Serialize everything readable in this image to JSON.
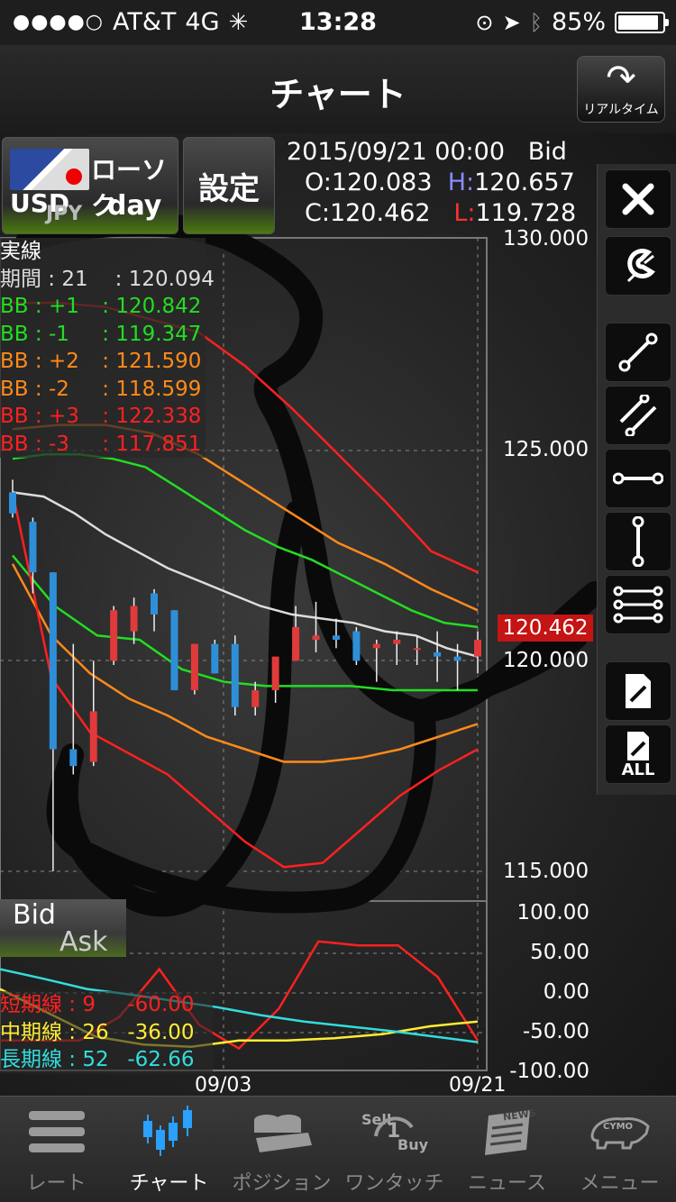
{
  "status_bar": {
    "signal": "●●●●○",
    "carrier": "AT&T",
    "network": "4G",
    "time": "13:28",
    "battery": "85%"
  },
  "nav": {
    "title": "チャート",
    "realtime_label": "リアルタイム"
  },
  "symbol_button": {
    "base": "USD",
    "quote": "JPY",
    "chart_type": "ローソク",
    "period": "day"
  },
  "settings_button": {
    "label": "設定"
  },
  "ohlc": {
    "datetime": "2015/09/21 00:00",
    "side": "Bid",
    "open_label": "O:",
    "open": "120.083",
    "high_label": "H:",
    "high": "120.657",
    "close_label": "C:",
    "close": "120.462",
    "low_label": "L:",
    "low": "119.728"
  },
  "main_legend": {
    "title": "実線",
    "rows": [
      {
        "name": "期間",
        "param": "21",
        "value": "120.094",
        "color": "#dddddd"
      },
      {
        "name": "BB",
        "param": "+1",
        "value": "120.842",
        "color": "#22dd22"
      },
      {
        "name": "BB",
        "param": "-1",
        "value": "119.347",
        "color": "#22dd22"
      },
      {
        "name": "BB",
        "param": "+2",
        "value": "121.590",
        "color": "#ff8a1a"
      },
      {
        "name": "BB",
        "param": "-2",
        "value": "118.599",
        "color": "#ff8a1a"
      },
      {
        "name": "BB",
        "param": "+3",
        "value": "122.338",
        "color": "#ff2020"
      },
      {
        "name": "BB",
        "param": "-3",
        "value": "117.851",
        "color": "#ff2020"
      }
    ]
  },
  "price_axis": {
    "ticks": [
      "130.000",
      "125.000",
      "120.000",
      "115.000"
    ],
    "current": "120.462"
  },
  "osc_toggle": {
    "bid": "Bid",
    "ask": "Ask"
  },
  "osc_legend": {
    "rows": [
      {
        "name": "短期線",
        "param": "9",
        "value": "-60.00",
        "color": "#ff2020"
      },
      {
        "name": "中期線",
        "param": "26",
        "value": "-36.00",
        "color": "#ffee33"
      },
      {
        "name": "長期線",
        "param": "52",
        "value": "-62.66",
        "color": "#33dddd"
      }
    ]
  },
  "osc_axis": {
    "ticks": [
      "100.00",
      "50.00",
      "0.00",
      "-50.00",
      "-100.00"
    ]
  },
  "date_axis": {
    "ticks": [
      "09/03",
      "09/21"
    ]
  },
  "toolbar": {
    "tools": [
      "close-icon",
      "magnet-icon",
      "trend-line-icon",
      "parallel-lines-icon",
      "horizontal-line-icon",
      "vertical-line-icon",
      "multi-line-icon",
      "erase-icon",
      "erase-all-icon"
    ],
    "erase_all_label": "ALL"
  },
  "tabbar": {
    "tabs": [
      {
        "label": "レート",
        "icon": "rate-list-icon",
        "active": false
      },
      {
        "label": "チャート",
        "icon": "chart-icon",
        "active": true
      },
      {
        "label": "ポジション",
        "icon": "position-icon",
        "active": false
      },
      {
        "label": "ワンタッチ",
        "icon": "one-touch-icon",
        "active": false
      },
      {
        "label": "ニュース",
        "icon": "news-icon",
        "active": false
      },
      {
        "label": "メニュー",
        "icon": "menu-icon",
        "active": false
      }
    ],
    "onetouch_sell": "Sell",
    "onetouch_buy": "Buy",
    "onetouch_num": "1",
    "news_badge": "NEWS",
    "menu_badge": "CYMO"
  },
  "chart_data": {
    "type": "candlestick",
    "series": [
      {
        "name": "期間",
        "period": 21,
        "color": "#dddddd",
        "values": [
          124.0,
          123.9,
          123.5,
          123.0,
          122.6,
          122.2,
          121.9,
          121.6,
          121.3,
          121.1,
          121.0,
          120.9,
          120.7,
          120.6,
          120.3,
          120.1
        ]
      },
      {
        "name": "BB +1",
        "color": "#22dd22",
        "values": [
          124.8,
          124.9,
          124.9,
          124.8,
          124.6,
          124.1,
          123.6,
          123.1,
          122.7,
          122.4,
          122.0,
          121.6,
          121.2,
          120.9,
          120.8
        ]
      },
      {
        "name": "BB -1",
        "color": "#22dd22",
        "values": [
          122.5,
          121.3,
          120.6,
          120.5,
          119.8,
          119.5,
          119.4,
          119.4,
          119.4,
          119.3,
          119.3,
          119.3
        ]
      },
      {
        "name": "BB +2",
        "color": "#ff8a1a",
        "values": [
          125.5,
          125.6,
          125.6,
          125.4,
          124.9,
          124.2,
          123.5,
          122.8,
          122.3,
          121.7,
          121.2
        ]
      },
      {
        "name": "BB -2",
        "color": "#ff8a1a",
        "values": [
          122.3,
          120.6,
          119.7,
          119.1,
          118.7,
          118.2,
          117.9,
          117.6,
          117.6,
          117.7,
          117.9,
          118.2,
          118.5
        ]
      },
      {
        "name": "BB +3",
        "color": "#ff2020",
        "values": [
          128.5,
          128.5,
          128.4,
          128.1,
          127.8,
          127.0,
          126.0,
          124.9,
          123.8,
          122.6,
          122.1
        ]
      },
      {
        "name": "BB -3",
        "color": "#ff2020",
        "values": [
          124.0,
          119.6,
          118.3,
          117.8,
          117.3,
          116.5,
          115.7,
          115.1,
          115.2,
          116.0,
          116.8,
          117.4,
          117.9
        ]
      }
    ],
    "candles": [
      {
        "o": 124.0,
        "h": 124.3,
        "c": 123.5,
        "l": 123.4
      },
      {
        "o": 123.3,
        "h": 123.4,
        "c": 122.1,
        "l": 121.6
      },
      {
        "o": 122.1,
        "h": 122.1,
        "c": 117.9,
        "l": 115.0
      },
      {
        "o": 117.9,
        "h": 120.4,
        "c": 117.5,
        "l": 117.3
      },
      {
        "o": 117.6,
        "h": 120.0,
        "c": 118.8,
        "l": 117.5
      },
      {
        "o": 120.0,
        "h": 121.3,
        "c": 121.2,
        "l": 119.9
      },
      {
        "o": 120.7,
        "h": 121.5,
        "c": 121.3,
        "l": 120.4
      },
      {
        "o": 121.6,
        "h": 121.7,
        "c": 121.1,
        "l": 120.7
      },
      {
        "o": 121.2,
        "h": 121.2,
        "c": 119.3,
        "l": 119.3
      },
      {
        "o": 119.3,
        "h": 120.4,
        "c": 120.4,
        "l": 119.2
      },
      {
        "o": 120.4,
        "h": 120.5,
        "c": 119.7,
        "l": 119.7
      },
      {
        "o": 120.4,
        "h": 120.6,
        "c": 118.9,
        "l": 118.7
      },
      {
        "o": 118.9,
        "h": 119.5,
        "c": 119.3,
        "l": 118.7
      },
      {
        "o": 119.3,
        "h": 119.5,
        "c": 120.1,
        "l": 119.0
      },
      {
        "o": 120.0,
        "h": 121.3,
        "c": 120.8,
        "l": 120.0
      },
      {
        "o": 120.5,
        "h": 121.4,
        "c": 120.6,
        "l": 120.2
      },
      {
        "o": 120.6,
        "h": 121.0,
        "c": 120.5,
        "l": 120.3
      },
      {
        "o": 120.7,
        "h": 120.8,
        "c": 120.0,
        "l": 119.9
      },
      {
        "o": 120.3,
        "h": 120.5,
        "c": 120.4,
        "l": 119.5
      },
      {
        "o": 120.4,
        "h": 120.7,
        "c": 120.5,
        "l": 119.9
      },
      {
        "o": 120.3,
        "h": 120.6,
        "c": 120.3,
        "l": 119.9
      },
      {
        "o": 120.2,
        "h": 120.7,
        "c": 120.1,
        "l": 119.5
      },
      {
        "o": 120.1,
        "h": 120.4,
        "c": 120.0,
        "l": 119.3
      },
      {
        "o": 120.1,
        "h": 120.7,
        "c": 120.5,
        "l": 119.7
      }
    ],
    "oscillator": {
      "ylim": [
        -100,
        100
      ],
      "series": [
        {
          "name": "短期線",
          "color": "#ff2020",
          "values": [
            -60,
            -60,
            -60,
            -30,
            30,
            -40,
            -70,
            -20,
            65,
            60,
            60,
            20,
            -60
          ]
        },
        {
          "name": "中期線",
          "color": "#ffee33",
          "values": [
            5,
            -25,
            -55,
            -65,
            -68,
            -60,
            -60,
            -57,
            -52,
            -42,
            -36
          ]
        },
        {
          "name": "長期線",
          "color": "#33dddd",
          "values": [
            30,
            18,
            5,
            -2,
            -10,
            -18,
            -28,
            -36,
            -42,
            -48,
            -55,
            -62
          ]
        }
      ]
    },
    "ylim": [
      115.0,
      130.0
    ],
    "x_ticks": [
      "09/03",
      "09/21"
    ]
  }
}
